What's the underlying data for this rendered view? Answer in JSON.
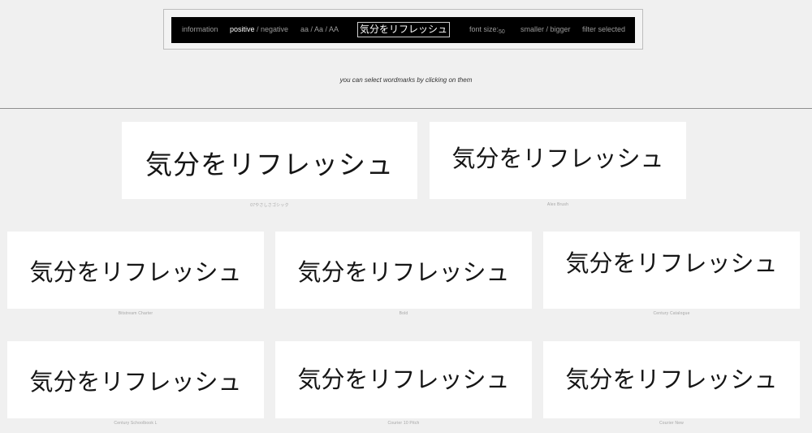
{
  "toolbar": {
    "information": "information",
    "positive": "positive",
    "slash1": " / ",
    "negative": "negative",
    "case_options": "aa / Aa / AA",
    "sample_text": "気分をリフレッシュ",
    "font_size_label": "font size:",
    "font_size_value": "50",
    "smaller": "smaller",
    "slash2": " / ",
    "bigger": "bigger",
    "filter_selected": "filter selected"
  },
  "hint": "you can select wordmarks by clicking on them",
  "cards": [
    {
      "text": "気分をリフレッシュ",
      "caption": "07やさしさゴシック"
    },
    {
      "text": "気分をリフレッシュ",
      "caption": "Alex Brush"
    },
    {
      "text": "気分をリフレッシュ",
      "caption": "Bitstream Charter"
    },
    {
      "text": "気分をリフレッシュ",
      "caption": "Bold"
    },
    {
      "text": "気分をリフレッシュ",
      "caption": "Century Catalogue"
    },
    {
      "text": "気分をリフレッシュ",
      "caption": "Century Schoolbook L"
    },
    {
      "text": "気分をリフレッシュ",
      "caption": "Courier 10 Pitch"
    },
    {
      "text": "気分をリフレッシュ",
      "caption": "Courier New"
    }
  ],
  "colors": {
    "background": "#f0f0f0",
    "toolbar": "#000000",
    "card": "#ffffff",
    "caption": "#a5a5a5"
  }
}
